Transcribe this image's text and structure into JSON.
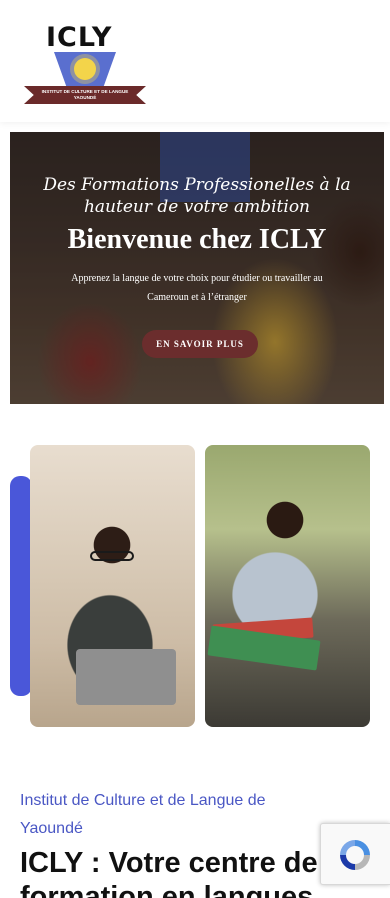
{
  "header": {
    "logo": {
      "letters": "ICLY",
      "ribbon_text": "INSTITUT DE CULTURE ET DE LANGUE YAOUNDÉ"
    }
  },
  "hero": {
    "script_line1": "Des Formations Professionelles à la",
    "script_line2": "hauteur de votre ambition",
    "title": "Bienvenue chez ICLY",
    "subtitle": "Apprenez la langue de votre choix pour étudier ou travailler au Cameroun et à l’étranger",
    "button_label": "EN SAVOIR PLUS"
  },
  "about": {
    "subtitle": "Institut de Culture et de Langue de Yaoundé",
    "headline": "ICLY : Votre centre de formation en langues"
  },
  "colors": {
    "accent_blue": "#4a57d9",
    "brand_maroon": "#6b2d2d",
    "subtitle_blue": "#4a57c4"
  },
  "icons": {
    "recaptcha": "recaptcha-icon"
  }
}
